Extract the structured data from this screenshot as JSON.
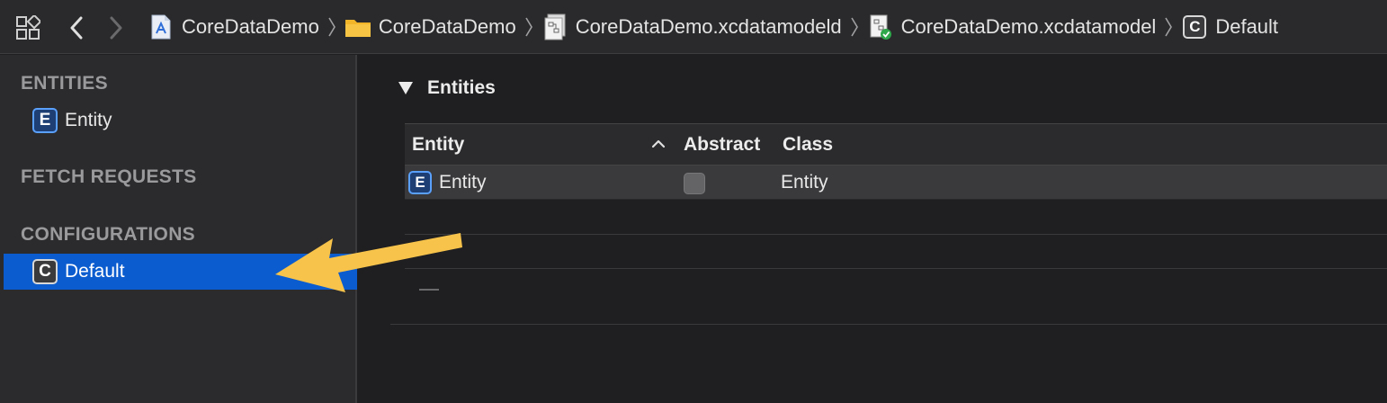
{
  "jumpbar": {
    "icons": {
      "related_items": "related-items-grid-icon",
      "back": "chevron-left-icon",
      "forward": "chevron-right-icon"
    },
    "breadcrumbs": [
      {
        "label": "CoreDataDemo",
        "icon": "xcode-project-icon"
      },
      {
        "label": "CoreDataDemo",
        "icon": "folder-icon"
      },
      {
        "label": "CoreDataDemo.xcdatamodeld",
        "icon": "data-model-bundle-icon"
      },
      {
        "label": "CoreDataDemo.xcdatamodel",
        "icon": "data-model-file-icon"
      },
      {
        "label": "Default",
        "icon": "configuration-icon"
      }
    ]
  },
  "sidebar": {
    "entities_header": "ENTITIES",
    "entities": [
      {
        "label": "Entity",
        "badge": "E"
      }
    ],
    "fetch_requests_header": "FETCH REQUESTS",
    "configurations_header": "CONFIGURATIONS",
    "configurations": [
      {
        "label": "Default",
        "badge": "C",
        "selected": true
      }
    ]
  },
  "main": {
    "section_title": "Entities",
    "table": {
      "columns": [
        "Entity",
        "Abstract",
        "Class"
      ],
      "sort_column": "Entity",
      "sort_direction": "ascending",
      "rows": [
        {
          "badge": "E",
          "entity": "Entity",
          "abstract": false,
          "class": "Entity"
        }
      ]
    }
  },
  "colors": {
    "selection": "#0b5ccf",
    "annotation_arrow": "#f7c34a",
    "entity_badge_border": "#5aa0ff"
  }
}
